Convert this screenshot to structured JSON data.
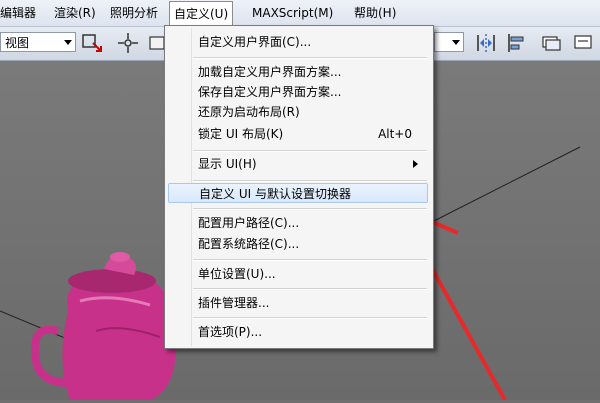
{
  "menubar": {
    "items": [
      "编辑器",
      "渲染(R)",
      "照明分析",
      "自定义(U)",
      "MAXScript(M)",
      "帮助(H)"
    ]
  },
  "toolbar": {
    "view_select": "视图",
    "right_select": ""
  },
  "menu": {
    "items": [
      {
        "label": "自定义用户界面(C)...",
        "shortcut": ""
      },
      {
        "label": "加载自定义用户界面方案...",
        "shortcut": ""
      },
      {
        "label": "保存自定义用户界面方案...",
        "shortcut": ""
      },
      {
        "label": "还原为启动布局(R)",
        "shortcut": ""
      },
      {
        "label": "锁定 UI 布局(K)",
        "shortcut": "Alt+0"
      },
      {
        "label": "显示 UI(H)",
        "shortcut": ""
      },
      {
        "label": "自定义 UI 与默认设置切换器",
        "shortcut": ""
      },
      {
        "label": "配置用户路径(C)...",
        "shortcut": ""
      },
      {
        "label": "配置系统路径(C)...",
        "shortcut": ""
      },
      {
        "label": "单位设置(U)...",
        "shortcut": ""
      },
      {
        "label": "插件管理器...",
        "shortcut": ""
      },
      {
        "label": "首选项(P)...",
        "shortcut": ""
      }
    ]
  },
  "colors": {
    "teapot": "#c8318a",
    "annotation_arrow": "#e8282a",
    "viewport_bg": "#6f6f6f"
  },
  "icons": [
    "select-move-icon",
    "pan-icon",
    "mirror-icon",
    "align-icon",
    "layer-icon",
    "render-setup-icon"
  ]
}
